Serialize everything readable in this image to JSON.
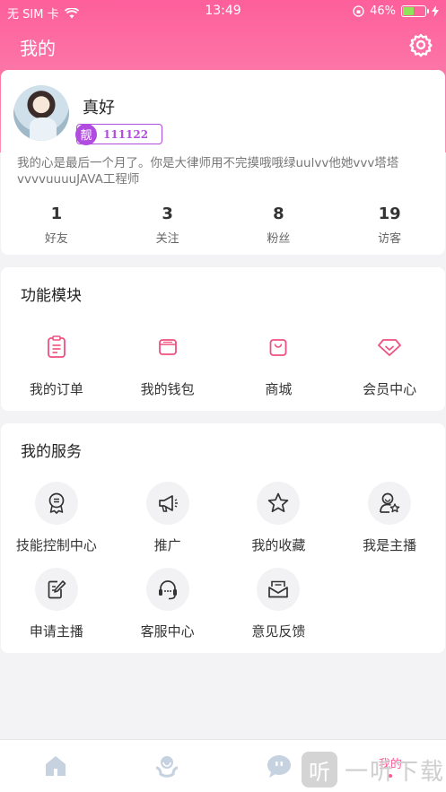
{
  "status_bar": {
    "carrier": "无 SIM 卡",
    "time": "13:49",
    "battery": "46%"
  },
  "header": {
    "title": "我的"
  },
  "profile": {
    "name": "真好",
    "badge_tag": "靓",
    "badge_number": "111122",
    "bio": "我的心是最后一个月了。你是大律师用不完摸哦哦绿uulvv他她vvv塔塔vvvvuuuuJAVA工程师",
    "stats": [
      {
        "value": "1",
        "label": "好友"
      },
      {
        "value": "3",
        "label": "关注"
      },
      {
        "value": "8",
        "label": "粉丝"
      },
      {
        "value": "19",
        "label": "访客"
      }
    ]
  },
  "features": {
    "title": "功能模块",
    "items": [
      {
        "label": "我的订单",
        "icon": "order-icon"
      },
      {
        "label": "我的钱包",
        "icon": "wallet-icon"
      },
      {
        "label": "商城",
        "icon": "shop-icon"
      },
      {
        "label": "会员中心",
        "icon": "diamond-icon"
      }
    ]
  },
  "services": {
    "title": "我的服务",
    "items": [
      {
        "label": "技能控制中心",
        "icon": "medal-icon"
      },
      {
        "label": "推广",
        "icon": "megaphone-icon"
      },
      {
        "label": "我的收藏",
        "icon": "star-icon"
      },
      {
        "label": "我是主播",
        "icon": "anchor-icon"
      },
      {
        "label": "申请主播",
        "icon": "edit-icon"
      },
      {
        "label": "客服中心",
        "icon": "headset-icon"
      },
      {
        "label": "意见反馈",
        "icon": "feedback-icon"
      }
    ]
  },
  "tabbar": {
    "items": [
      {
        "label": "",
        "icon": "home-icon"
      },
      {
        "label": "",
        "icon": "discover-icon"
      },
      {
        "label": "",
        "icon": "message-icon"
      },
      {
        "label": "我的",
        "icon": "",
        "active": true
      }
    ]
  },
  "watermark": {
    "text": "一听下载",
    "glyph": "听"
  },
  "colors": {
    "accent": "#fb5a95",
    "badge": "#b14ce0"
  }
}
